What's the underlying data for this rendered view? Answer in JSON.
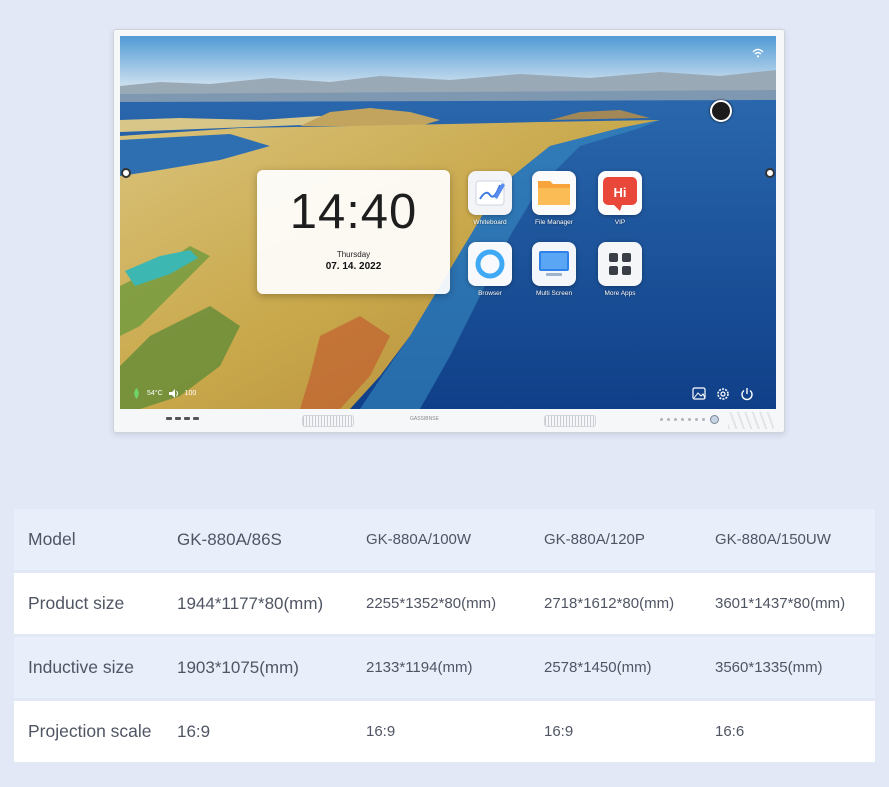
{
  "screen": {
    "clock": {
      "time": "14:40",
      "day": "Thursday",
      "date": "07. 14. 2022"
    },
    "apps": [
      {
        "label": "Whiteboard",
        "icon": "whiteboard-icon"
      },
      {
        "label": "File Manager",
        "icon": "folder-icon"
      },
      {
        "label": "VIP",
        "icon": "vip-icon",
        "icon_text": "Hi"
      },
      {
        "label": "Browser",
        "icon": "browser-icon"
      },
      {
        "label": "Multi Screen",
        "icon": "multi-screen-icon"
      },
      {
        "label": "More Apps",
        "icon": "more-apps-icon"
      }
    ],
    "status": {
      "temperature": "54°C",
      "volume": "100"
    },
    "brand": "GASSIBNSE"
  },
  "colors": {
    "page_bg": "#e3e8f6",
    "row_shaded": "#e9eefb",
    "row_plain": "#ffffff",
    "text": "#4f5563",
    "vip_red": "#e8473a",
    "file_orange": "#f7a43c",
    "browser_blue": "#3fa9f5"
  },
  "spec_table": {
    "rows": [
      {
        "label": "Model",
        "values": [
          "GK-880A/86S",
          "GK-880A/100W",
          "GK-880A/120P",
          "GK-880A/150UW"
        ]
      },
      {
        "label": "Product size",
        "values": [
          "1944*1177*80(mm)",
          "2255*1352*80(mm)",
          "2718*1612*80(mm)",
          "3601*1437*80(mm)"
        ]
      },
      {
        "label": "Inductive size",
        "values": [
          "1903*1075(mm)",
          "2133*1194(mm)",
          "2578*1450(mm)",
          "3560*1335(mm)"
        ]
      },
      {
        "label": "Projection scale",
        "values": [
          "16:9",
          "16:9",
          "16:9",
          "16:6"
        ]
      }
    ]
  }
}
